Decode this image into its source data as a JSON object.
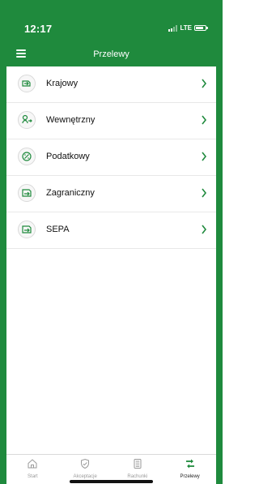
{
  "status_bar": {
    "time": "12:17",
    "network": "LTE"
  },
  "header": {
    "title": "Przelewy"
  },
  "transfers": [
    {
      "label": "Krajowy",
      "icon": "domestic-transfer-icon"
    },
    {
      "label": "Wewnętrzny",
      "icon": "internal-transfer-icon"
    },
    {
      "label": "Podatkowy",
      "icon": "tax-transfer-icon"
    },
    {
      "label": "Zagraniczny",
      "icon": "foreign-transfer-icon"
    },
    {
      "label": "SEPA",
      "icon": "sepa-transfer-icon"
    }
  ],
  "bottom_nav": [
    {
      "label": "Start",
      "icon": "home-icon",
      "active": false
    },
    {
      "label": "Akceptacje",
      "icon": "shield-check-icon",
      "active": false
    },
    {
      "label": "Rachunki",
      "icon": "document-icon",
      "active": false
    },
    {
      "label": "Przelewy",
      "icon": "transfer-arrows-icon",
      "active": true
    }
  ],
  "colors": {
    "brand_green": "#1f8a3d",
    "chevron_green": "#1f8a3d",
    "divider": "#e8e8e8",
    "inactive_nav_text": "#9a9a9a"
  }
}
